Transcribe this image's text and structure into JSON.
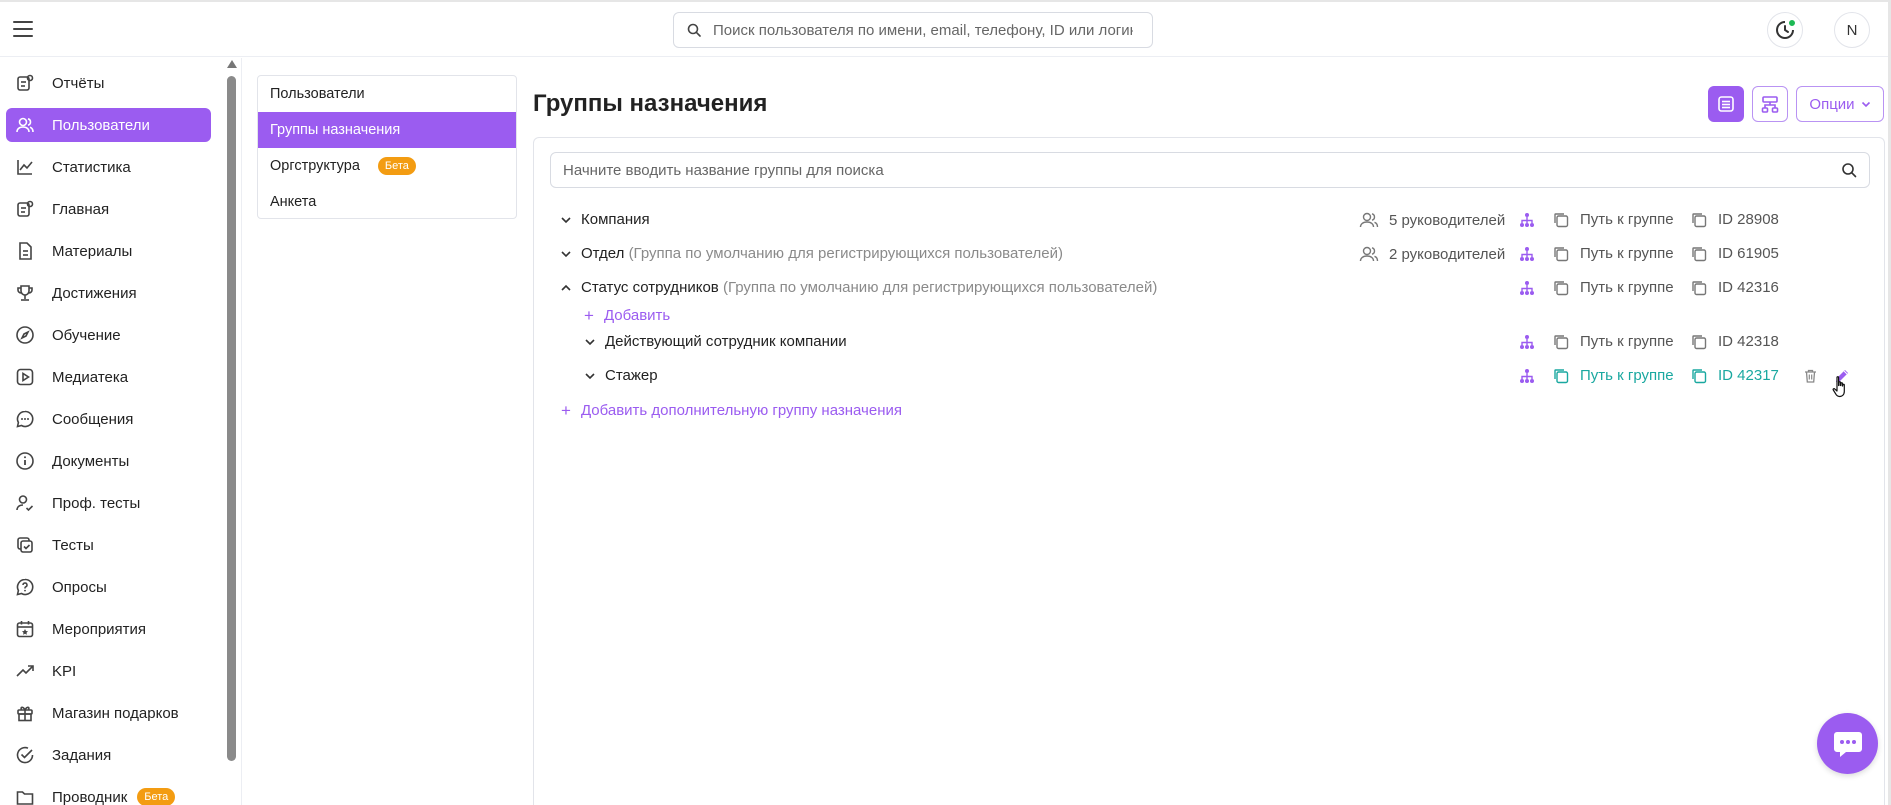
{
  "header": {
    "search_placeholder": "Поиск пользователя по имени, email, телефону, ID или логину",
    "avatar_initial": "N"
  },
  "sidebar": {
    "items": [
      {
        "label": "Отчёты",
        "icon": "report-icon"
      },
      {
        "label": "Пользователи",
        "icon": "users-icon",
        "active": true
      },
      {
        "label": "Статистика",
        "icon": "chart-line-icon"
      },
      {
        "label": "Главная",
        "icon": "home-icon"
      },
      {
        "label": "Материалы",
        "icon": "file-icon"
      },
      {
        "label": "Достижения",
        "icon": "trophy-icon"
      },
      {
        "label": "Обучение",
        "icon": "compass-icon"
      },
      {
        "label": "Медиатека",
        "icon": "play-icon"
      },
      {
        "label": "Сообщения",
        "icon": "chat-icon"
      },
      {
        "label": "Документы",
        "icon": "info-icon"
      },
      {
        "label": "Проф. тесты",
        "icon": "user-check-icon"
      },
      {
        "label": "Тесты",
        "icon": "checklist-icon"
      },
      {
        "label": "Опросы",
        "icon": "question-icon"
      },
      {
        "label": "Мероприятия",
        "icon": "calendar-icon"
      },
      {
        "label": "KPI",
        "icon": "trend-icon"
      },
      {
        "label": "Магазин подарков",
        "icon": "gift-icon"
      },
      {
        "label": "Задания",
        "icon": "check-circle-icon"
      },
      {
        "label": "Проводник",
        "icon": "folder-icon",
        "badge": "Бета"
      }
    ]
  },
  "subnav": {
    "items": [
      {
        "label": "Пользователи"
      },
      {
        "label": "Группы назначения",
        "active": true
      },
      {
        "label": "Оргструктура",
        "badge": "Бета"
      },
      {
        "label": "Анкета"
      }
    ]
  },
  "main": {
    "title": "Группы назначения",
    "options_label": "Опции",
    "group_search_placeholder": "Начните вводить название группы для поиска",
    "groups": [
      {
        "name": "Компания",
        "hint": "",
        "managers": "5 руководителей",
        "path": "Путь к группе",
        "id": "ID 28908",
        "expanded": false
      },
      {
        "name": "Отдел",
        "hint": "(Группа по умолчанию для регистрирующихся пользователей)",
        "managers": "2 руководителей",
        "path": "Путь к группе",
        "id": "ID 61905",
        "expanded": false
      },
      {
        "name": "Статус сотрудников",
        "hint": "(Группа по умолчанию для регистрирующихся пользователей)",
        "managers": "",
        "path": "Путь к группе",
        "id": "ID 42316",
        "expanded": true
      }
    ],
    "add_label": "Добавить",
    "subgroups": [
      {
        "name": "Действующий сотрудник компании",
        "path": "Путь к группе",
        "id": "ID 42318"
      },
      {
        "name": "Стажер",
        "path": "Путь к группе",
        "id": "ID 42317",
        "highlighted": true
      }
    ],
    "add_extra_label": "Добавить дополнительную группу назначения"
  },
  "colors": {
    "accent": "#9b5cf0",
    "teal": "#1aa8a0",
    "beta": "#f39c12",
    "online": "#1db954"
  }
}
